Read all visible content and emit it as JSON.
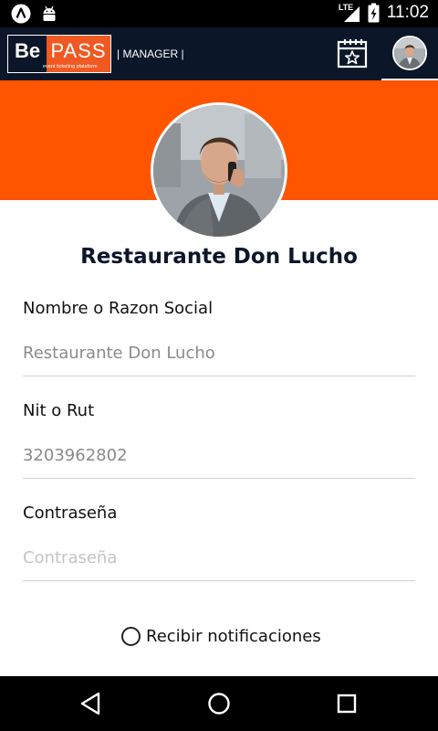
{
  "status_bar": {
    "time": "11:02",
    "network": "LTE",
    "icons": [
      "app-a-icon",
      "android-icon",
      "signal-icon",
      "battery-charging-icon"
    ]
  },
  "app_bar": {
    "logo_be": "Be",
    "logo_pass": "PASS",
    "logo_tagline": "event ticketing plataform",
    "manager_label": "| MANAGER |",
    "icons": [
      "calendar-star-icon",
      "avatar"
    ]
  },
  "profile": {
    "name": "Restaurante Don Lucho"
  },
  "form": {
    "business_name": {
      "label": "Nombre o Razon Social",
      "value": "Restaurante Don Lucho"
    },
    "tax_id": {
      "label": "Nit o Rut",
      "value": "3203962802"
    },
    "password": {
      "label": "Contraseña",
      "placeholder": "Contraseña"
    },
    "notifications": {
      "label": "Recibir notificaciones",
      "checked": false
    }
  },
  "colors": {
    "app_bar": "#0b1629",
    "accent": "#ff5500",
    "logo_pass": "#f05a22"
  },
  "nav_bar": {
    "icons": [
      "back-icon",
      "home-icon",
      "recents-icon"
    ]
  }
}
